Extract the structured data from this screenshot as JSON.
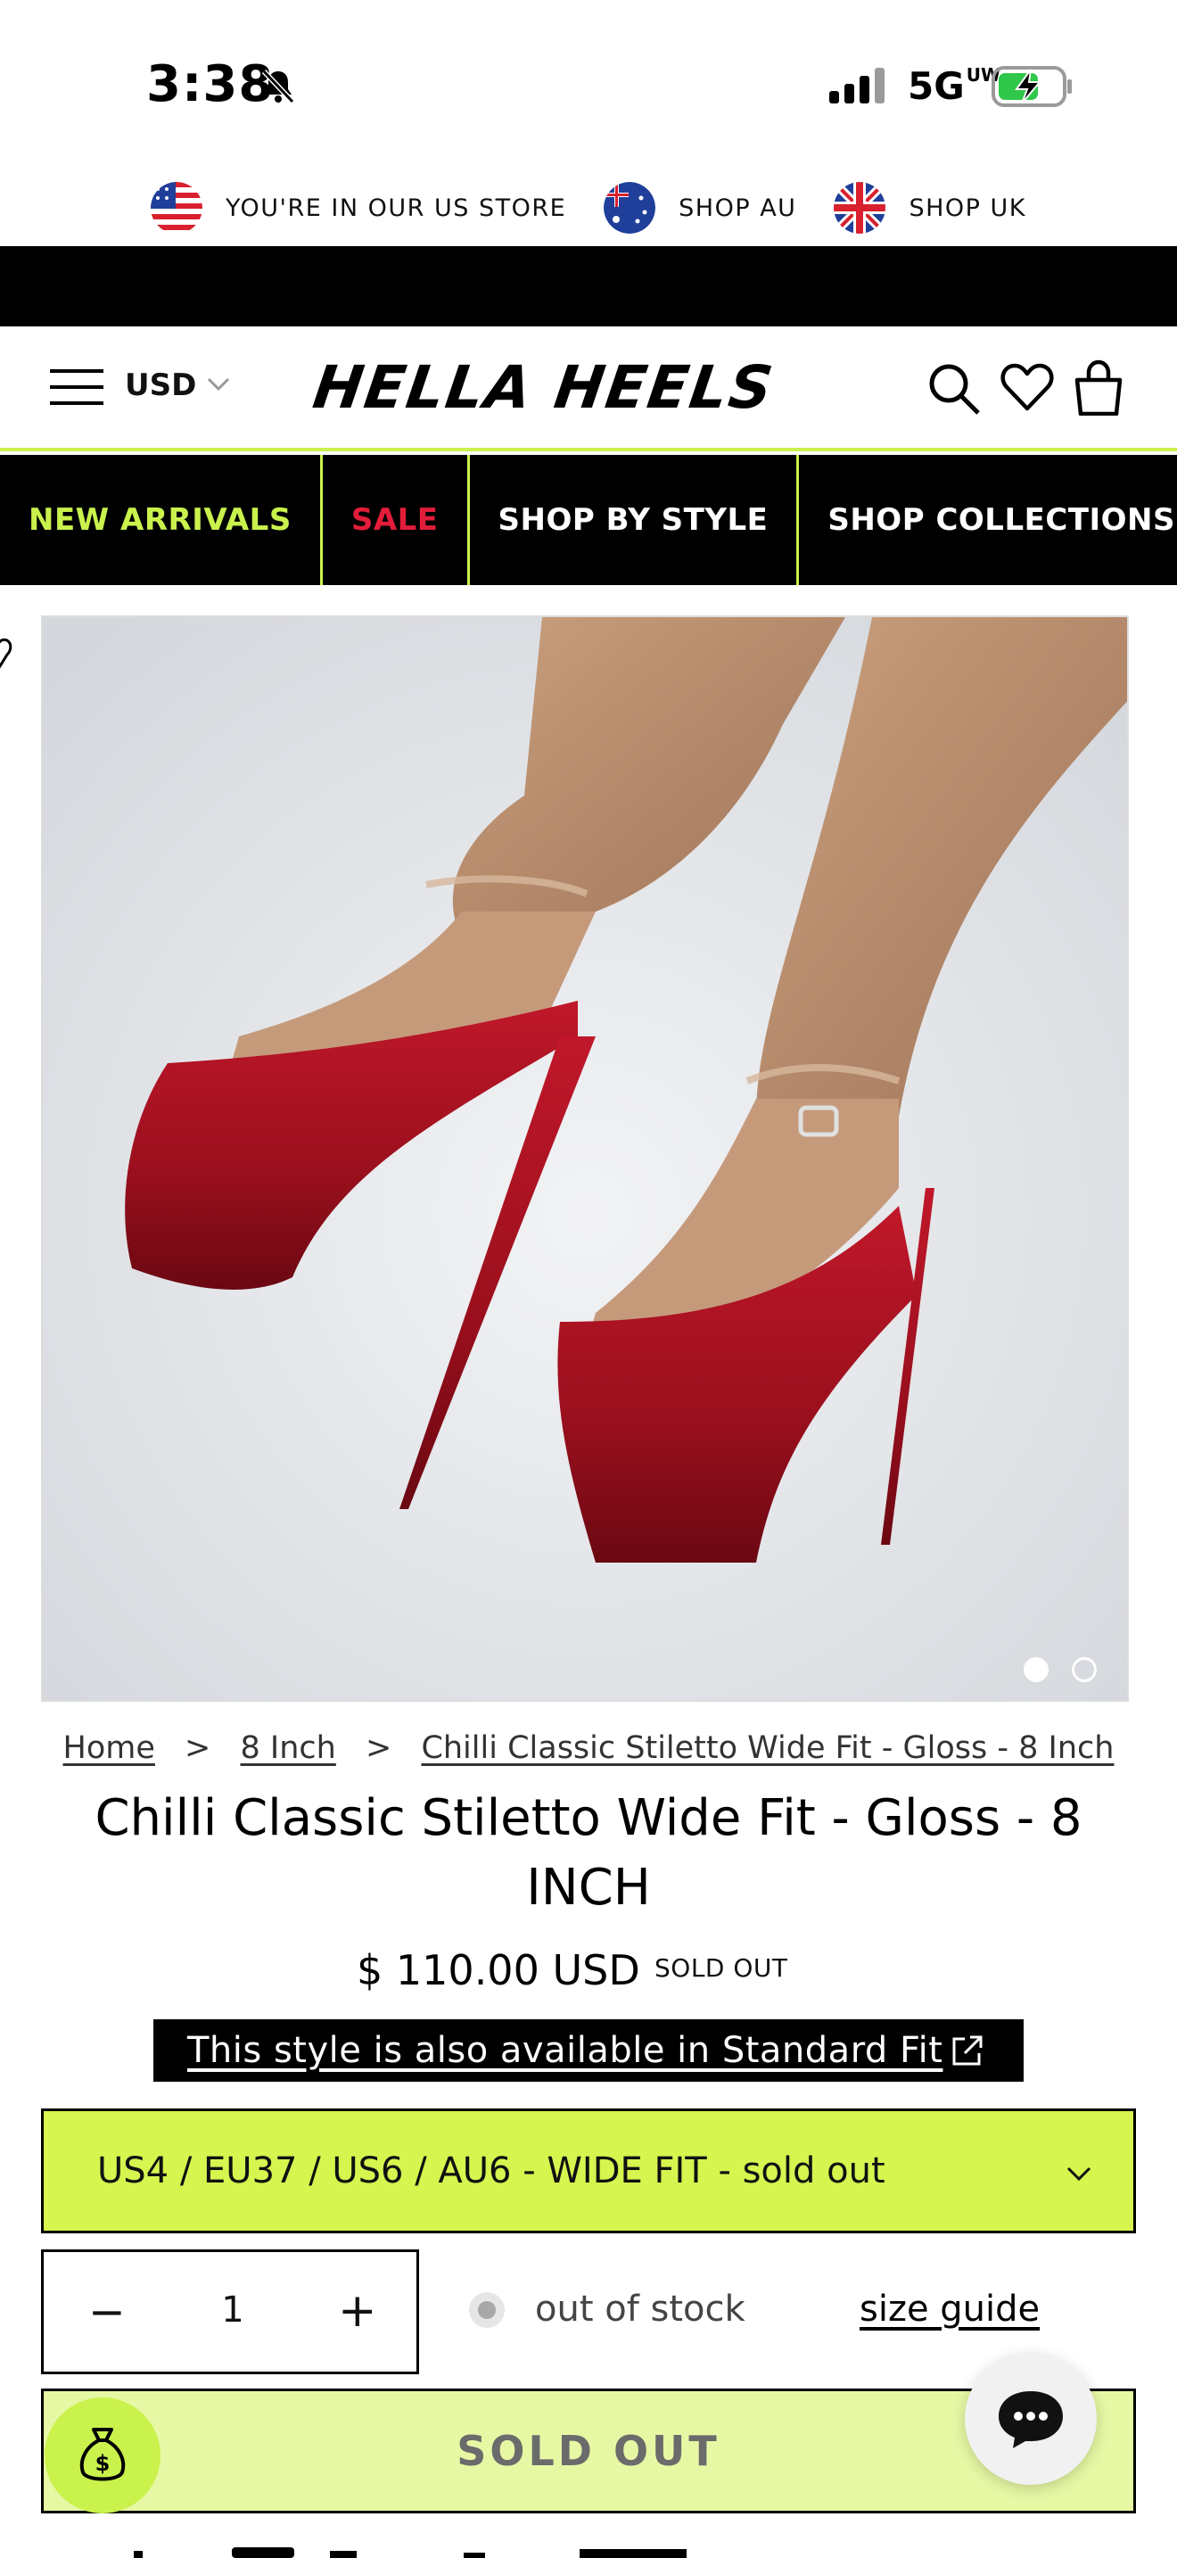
{
  "status": {
    "time": "3:38",
    "network": "5G",
    "network_suffix": "UW"
  },
  "store_bar": {
    "items": [
      {
        "flag": "us-flag-icon",
        "label": "YOU'RE IN OUR US STORE"
      },
      {
        "flag": "au-flag-icon",
        "label": "SHOP AU"
      },
      {
        "flag": "uk-flag-icon",
        "label": "SHOP UK"
      }
    ]
  },
  "header": {
    "currency": "USD",
    "logo": "HELLA HEELS"
  },
  "nav": {
    "items": [
      {
        "label": "NEW ARRIVALS",
        "color": "#c9f24c"
      },
      {
        "label": "SALE",
        "color": "#e11d3a"
      },
      {
        "label": "SHOP BY STYLE",
        "color": "#ffffff"
      },
      {
        "label": "SHOP COLLECTIONS",
        "color": "#ffffff"
      }
    ]
  },
  "gallery": {
    "image_count": 2,
    "active_index": 0
  },
  "breadcrumb": {
    "items": [
      "Home",
      "8 Inch",
      "Chilli Classic Stiletto Wide Fit - Gloss - 8 Inch"
    ]
  },
  "product": {
    "title": "Chilli Classic Stiletto Wide Fit - Gloss - 8 INCH",
    "price": "$ 110.00 USD",
    "badge": "SOLD OUT",
    "alt_fit_link": "This style is also available in Standard Fit",
    "variant": "US4 / EU37 / US6 / AU6 - WIDE FIT - sold out",
    "quantity": "1",
    "quantity_minus": "−",
    "quantity_plus": "+",
    "stock_status": "out of stock",
    "size_guide": "size guide",
    "cta": "SOLD OUT"
  },
  "colors": {
    "accent": "#c9f24c",
    "sale": "#e11d3a",
    "variant_bg": "#d6f54f",
    "cta_bg": "#e6f8a4"
  }
}
